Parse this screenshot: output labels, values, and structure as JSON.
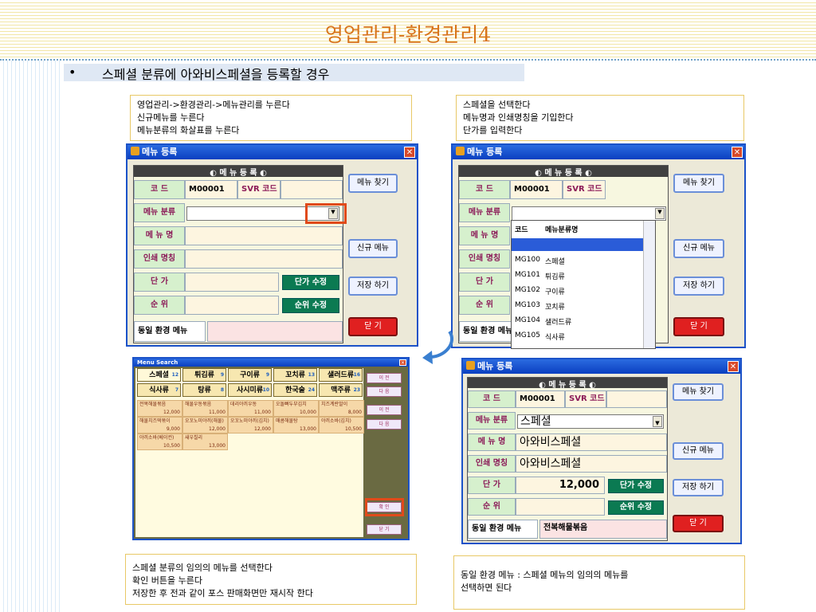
{
  "slide": {
    "title": "영업관리-환경관리4",
    "bullet": "•",
    "heading": "스페셜 분류에 아와비스페셜을 등록할 경우"
  },
  "notes": {
    "top_left": [
      "영업관리->환경관리->메뉴관리를 누른다",
      "신규메뉴를 누른다",
      "메뉴분류의 화살표를 누른다"
    ],
    "top_right": [
      "스페셜을 선택한다",
      "메뉴명과 인쇄명칭을 기입한다",
      "단가를 입력한다"
    ],
    "bottom_left": [
      "스페셜 분류의 임의의 메뉴를 선택한다",
      "확인 버튼을 누른다",
      "저장한 후 전과 같이 포스 판매화면만 재시작 한다"
    ],
    "bottom_right": [
      "동일 환경 메뉴 : 스페셜 메뉴의 임의의 메뉴를",
      "선택하면 된다"
    ]
  },
  "dialog": {
    "title": "메뉴 등록",
    "close": "✕",
    "header": "◐ 메  뉴   등  록  ◐",
    "code_label": "코  드",
    "code_value": "M00001",
    "svr_code_label": "SVR 코드",
    "category_label": "메뉴 분류",
    "name_label": "메 뉴 명",
    "print_label": "인쇄 명칭",
    "price_label": "단  가",
    "order_label": "순  위",
    "price_edit": "단가 수정",
    "order_edit": "순위 수정",
    "same_env_label": "동일 환경 메뉴",
    "find_menu": "메뉴 찾기",
    "new_menu": "신규 메뉴",
    "save": "저장 하기",
    "close_btn": "닫  기",
    "arrow": "▼"
  },
  "dropdown": {
    "header_code": "코드",
    "header_name": "메뉴분류명",
    "items": [
      {
        "code": "MG100",
        "name": "스페셜"
      },
      {
        "code": "MG101",
        "name": "튀김류"
      },
      {
        "code": "MG102",
        "name": "구이류"
      },
      {
        "code": "MG103",
        "name": "꼬치류"
      },
      {
        "code": "MG104",
        "name": "샐러드류"
      },
      {
        "code": "MG105",
        "name": "식사류"
      }
    ]
  },
  "filled": {
    "category": "스페셜",
    "name": "아와비스페셜",
    "print": "아와비스페셜",
    "price": "12,000",
    "same_env": "전복해물볶음"
  },
  "menu_search": {
    "title": "Menu Search",
    "tabs_row1": [
      {
        "label": "스페셜",
        "n": "12"
      },
      {
        "label": "튀김류",
        "n": "9"
      },
      {
        "label": "구이류",
        "n": "9"
      },
      {
        "label": "꼬치류",
        "n": "13"
      },
      {
        "label": "샐러드류",
        "n": "16"
      }
    ],
    "tabs_row2": [
      {
        "label": "식사류",
        "n": "7"
      },
      {
        "label": "탕류",
        "n": "8"
      },
      {
        "label": "사시미류",
        "n": "10"
      },
      {
        "label": "한국술",
        "n": "24"
      },
      {
        "label": "맥주류",
        "n": "23"
      }
    ],
    "items": [
      {
        "name": "전복해물볶음",
        "price": "12,000"
      },
      {
        "name": "해물우동볶음",
        "price": "11,000"
      },
      {
        "name": "데리야끼우동",
        "price": "11,000"
      },
      {
        "name": "오돌뼈두부김치",
        "price": "10,000"
      },
      {
        "name": "치즈계란말이",
        "price": "8,000"
      },
      {
        "name": "해물치즈떡볶이",
        "price": "9,000"
      },
      {
        "name": "오꼬노미야끼(해물)",
        "price": "12,000"
      },
      {
        "name": "오꼬노미야끼(김치)",
        "price": "12,000"
      },
      {
        "name": "매콤해물탕",
        "price": "13,000"
      },
      {
        "name": "야끼소바(김치)",
        "price": "10,500"
      },
      {
        "name": "야끼소바(베이컨)",
        "price": "10,500"
      },
      {
        "name": "새우칠리",
        "price": "13,000"
      }
    ],
    "prev": "이 전",
    "next": "다 음",
    "ok": "확 인",
    "close": "닫 기",
    "close_x": "✕"
  }
}
